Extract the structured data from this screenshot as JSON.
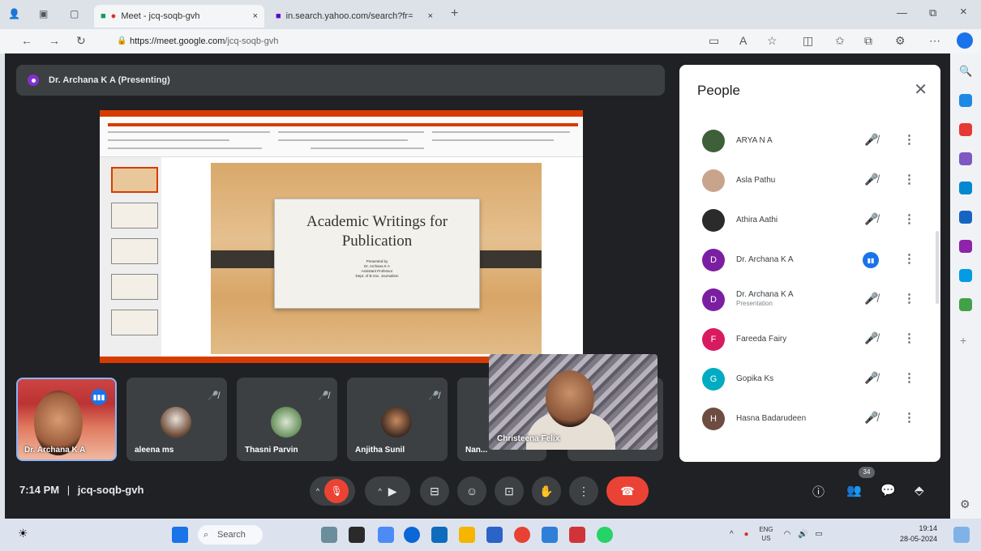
{
  "browser": {
    "tabs": [
      {
        "title": "Meet - jcq-soqb-gvh",
        "active": true
      },
      {
        "title": "in.search.yahoo.com/search?fr=",
        "active": false
      }
    ],
    "url_domain": "https://meet.google.com",
    "url_path": "/jcq-soqb-gvh"
  },
  "meet": {
    "banner": "Dr. Archana K A (Presenting)",
    "slide": {
      "title_line1": "Academic Writings for",
      "title_line2": "Publication",
      "sub1": "Presented by",
      "sub2": "Dr. Archana K A",
      "sub3": "Assistant Professor",
      "sub4": "Dept. of B.Voc. Journalism"
    },
    "tiles": [
      {
        "name": "Dr. Archana K A",
        "self": true
      },
      {
        "name": "aleena ms"
      },
      {
        "name": "Thasni Parvin"
      },
      {
        "name": "Anjitha Sunil"
      },
      {
        "name": "Nan..."
      }
    ],
    "pip_name": "Christeena Felix",
    "clock": "7:14 PM",
    "separator": "|",
    "meeting_code": "jcq-soqb-gvh",
    "people_count": "34"
  },
  "people_panel": {
    "title": "People",
    "participants": [
      {
        "name": "ARYA N A",
        "avatar": "photo",
        "color": "#3e5f3a",
        "initial": ""
      },
      {
        "name": "Asla Pathu",
        "avatar": "photo",
        "color": "#c9a48c",
        "initial": ""
      },
      {
        "name": "Athira Aathi",
        "avatar": "photo",
        "color": "#2b2b2b",
        "initial": ""
      },
      {
        "name": "Dr. Archana K A",
        "avatar": "letter",
        "color": "#7b1fa2",
        "initial": "D",
        "speaking": true
      },
      {
        "name": "Dr. Archana K A",
        "sub": "Presentation",
        "avatar": "letter",
        "color": "#7b1fa2",
        "initial": "D"
      },
      {
        "name": "Fareeda Fairy",
        "avatar": "letter",
        "color": "#d81b60",
        "initial": "F"
      },
      {
        "name": "Gopika Ks",
        "avatar": "letter",
        "color": "#00acc1",
        "initial": "G"
      },
      {
        "name": "Hasna Badarudeen",
        "avatar": "letter",
        "color": "#6d4c41",
        "initial": "H"
      }
    ]
  },
  "taskbar": {
    "search_placeholder": "Search",
    "lang": "ENG",
    "lang_sub": "US",
    "time": "19:14",
    "date": "28-05-2024"
  }
}
